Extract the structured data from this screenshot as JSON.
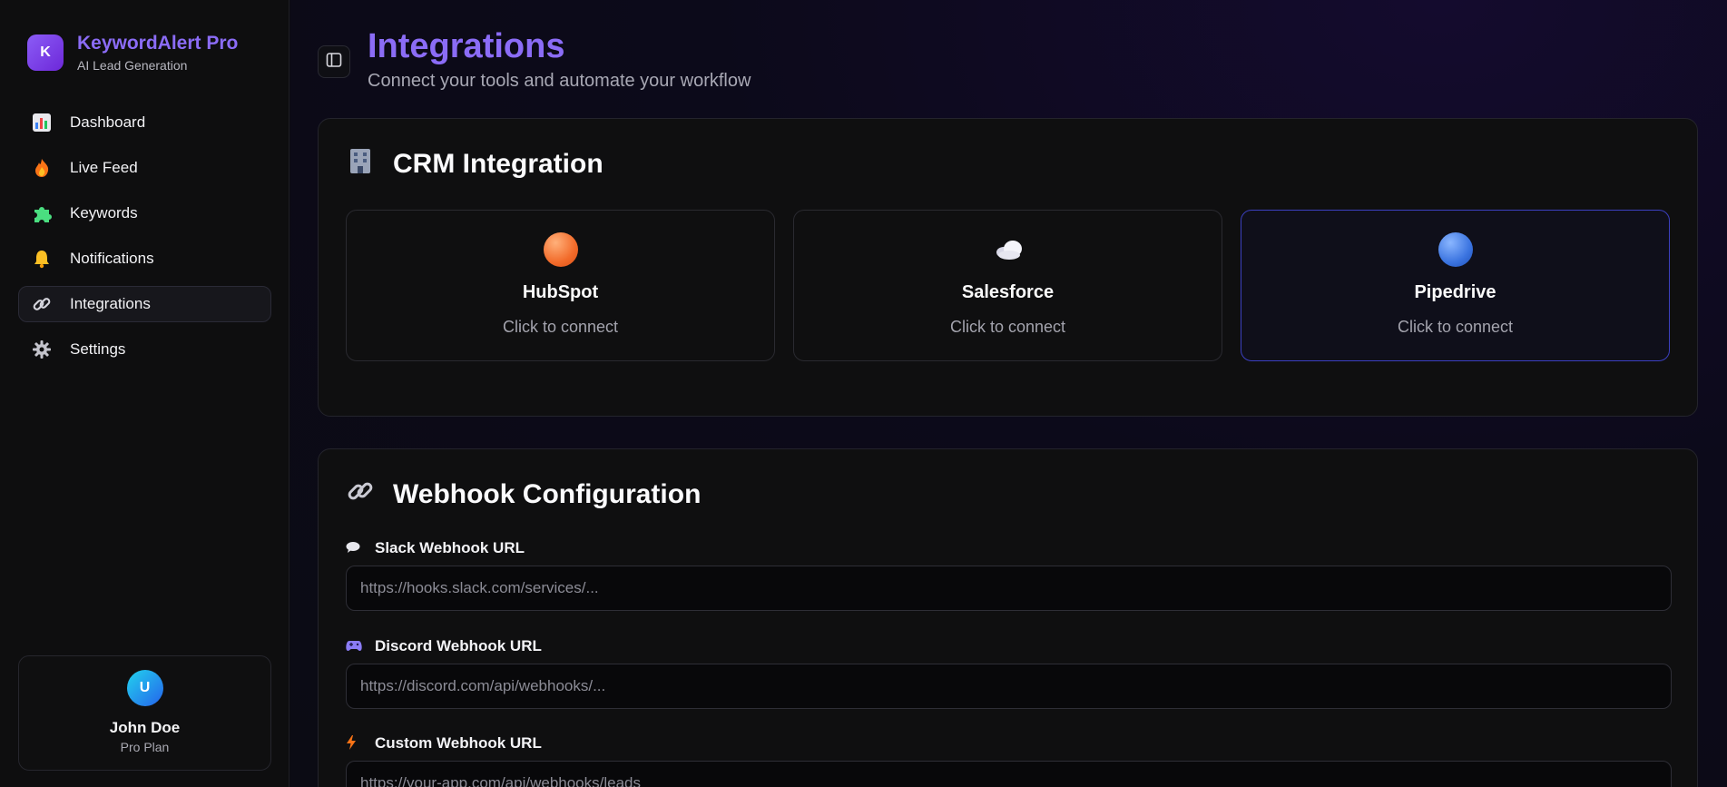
{
  "brand": {
    "logo_letter": "K",
    "title": "KeywordAlert Pro",
    "subtitle": "AI Lead Generation",
    "color": "#8b6cf6"
  },
  "sidebar": {
    "items": [
      {
        "label": "Dashboard",
        "icon": "bar-chart-icon",
        "active": false
      },
      {
        "label": "Live Feed",
        "icon": "fire-icon",
        "active": false
      },
      {
        "label": "Keywords",
        "icon": "puzzle-icon",
        "active": false
      },
      {
        "label": "Notifications",
        "icon": "bell-icon",
        "active": false
      },
      {
        "label": "Integrations",
        "icon": "link-icon",
        "active": true
      },
      {
        "label": "Settings",
        "icon": "gear-icon",
        "active": false
      }
    ]
  },
  "user": {
    "initial": "U",
    "name": "John Doe",
    "plan": "Pro Plan"
  },
  "header": {
    "title": "Integrations",
    "subtitle": "Connect your tools and automate your workflow"
  },
  "crm": {
    "title": "CRM Integration",
    "icon": "office-building-icon",
    "cards": [
      {
        "name": "HubSpot",
        "status": "Click to connect",
        "icon": "orange-circle-icon"
      },
      {
        "name": "Salesforce",
        "status": "Click to connect",
        "icon": "cloud-icon"
      },
      {
        "name": "Pipedrive",
        "status": "Click to connect",
        "icon": "blue-circle-icon",
        "selected": true
      }
    ]
  },
  "webhook": {
    "title": "Webhook Configuration",
    "icon": "link-icon",
    "fields": [
      {
        "label": "Slack Webhook URL",
        "icon": "speech-bubble-icon",
        "placeholder": "https://hooks.slack.com/services/..."
      },
      {
        "label": "Discord Webhook URL",
        "icon": "game-controller-icon",
        "placeholder": "https://discord.com/api/webhooks/..."
      },
      {
        "label": "Custom Webhook URL",
        "icon": "lightning-icon",
        "placeholder": "https://your-app.com/api/webhooks/leads"
      }
    ]
  }
}
